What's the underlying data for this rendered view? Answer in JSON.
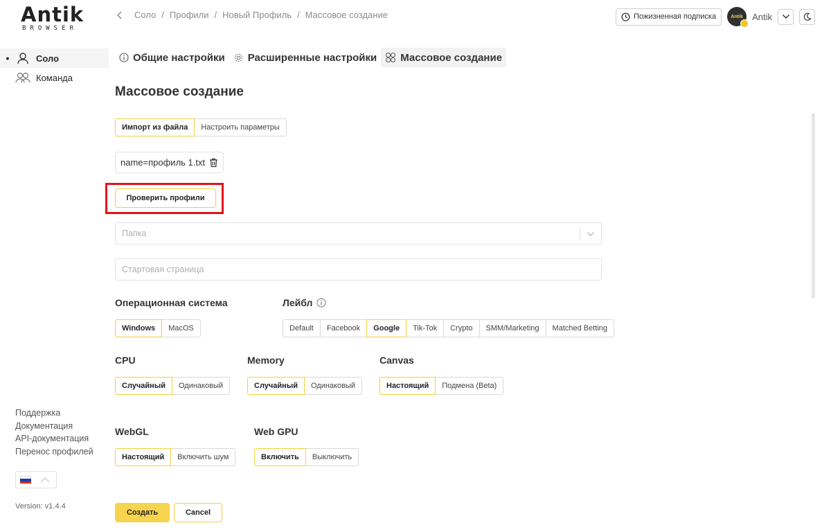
{
  "brand": {
    "logo_main": "Antik",
    "logo_sub": "BROWSER"
  },
  "sidebar": {
    "items": [
      {
        "label": "Соло",
        "icon": "user-icon",
        "active": true
      },
      {
        "label": "Команда",
        "icon": "team-icon",
        "active": false
      }
    ],
    "links": [
      "Поддержка",
      "Документация",
      "API-документация",
      "Перенос профилей"
    ],
    "language_flag": "ru-flag",
    "version": "Version: v1.4.4"
  },
  "header": {
    "breadcrumb": [
      "Соло",
      "Профили",
      "Новый Профиль",
      "Массовое создание"
    ],
    "subscription_label": "Пожизненная подписка",
    "avatar_text": "Antik",
    "username": "Antik"
  },
  "tabs": [
    {
      "label": "Общие настройки",
      "icon": "info-icon"
    },
    {
      "label": "Расширенные настройки",
      "icon": "gear-icon"
    },
    {
      "label": "Массовое создание",
      "icon": "grid-icon",
      "active": true
    }
  ],
  "page": {
    "title": "Массовое создание",
    "mode": {
      "options": [
        "Импорт из файла",
        "Настроить параметры"
      ],
      "selected": 0
    },
    "file_name": "name=профиль 1.txt",
    "check_button": "Проверить профили",
    "folder_placeholder": "Папка",
    "start_page_placeholder": "Стартовая страница",
    "os": {
      "label": "Операционная система",
      "options": [
        "Windows",
        "MacOS"
      ],
      "selected": 0
    },
    "label_group": {
      "label": "Лейбл",
      "options": [
        "Default",
        "Facebook",
        "Google",
        "Tik-Tok",
        "Crypto",
        "SMM/Marketing",
        "Matched Betting"
      ],
      "selected": 2
    },
    "cpu": {
      "label": "CPU",
      "options": [
        "Случайный",
        "Одинаковый"
      ],
      "selected": 0
    },
    "memory": {
      "label": "Memory",
      "options": [
        "Случайный",
        "Одинаковый"
      ],
      "selected": 0
    },
    "canvas": {
      "label": "Canvas",
      "options": [
        "Настоящий",
        "Подмена (Beta)"
      ],
      "selected": 0
    },
    "webgl": {
      "label": "WebGL",
      "options": [
        "Настоящий",
        "Включить шум"
      ],
      "selected": 0
    },
    "webgpu": {
      "label": "Web GPU",
      "options": [
        "Включить",
        "Выключить"
      ],
      "selected": 0
    },
    "create_button": "Создать",
    "cancel_button": "Cancel"
  },
  "colors": {
    "accent": "#f7d44e",
    "highlight": "#e3121b"
  }
}
